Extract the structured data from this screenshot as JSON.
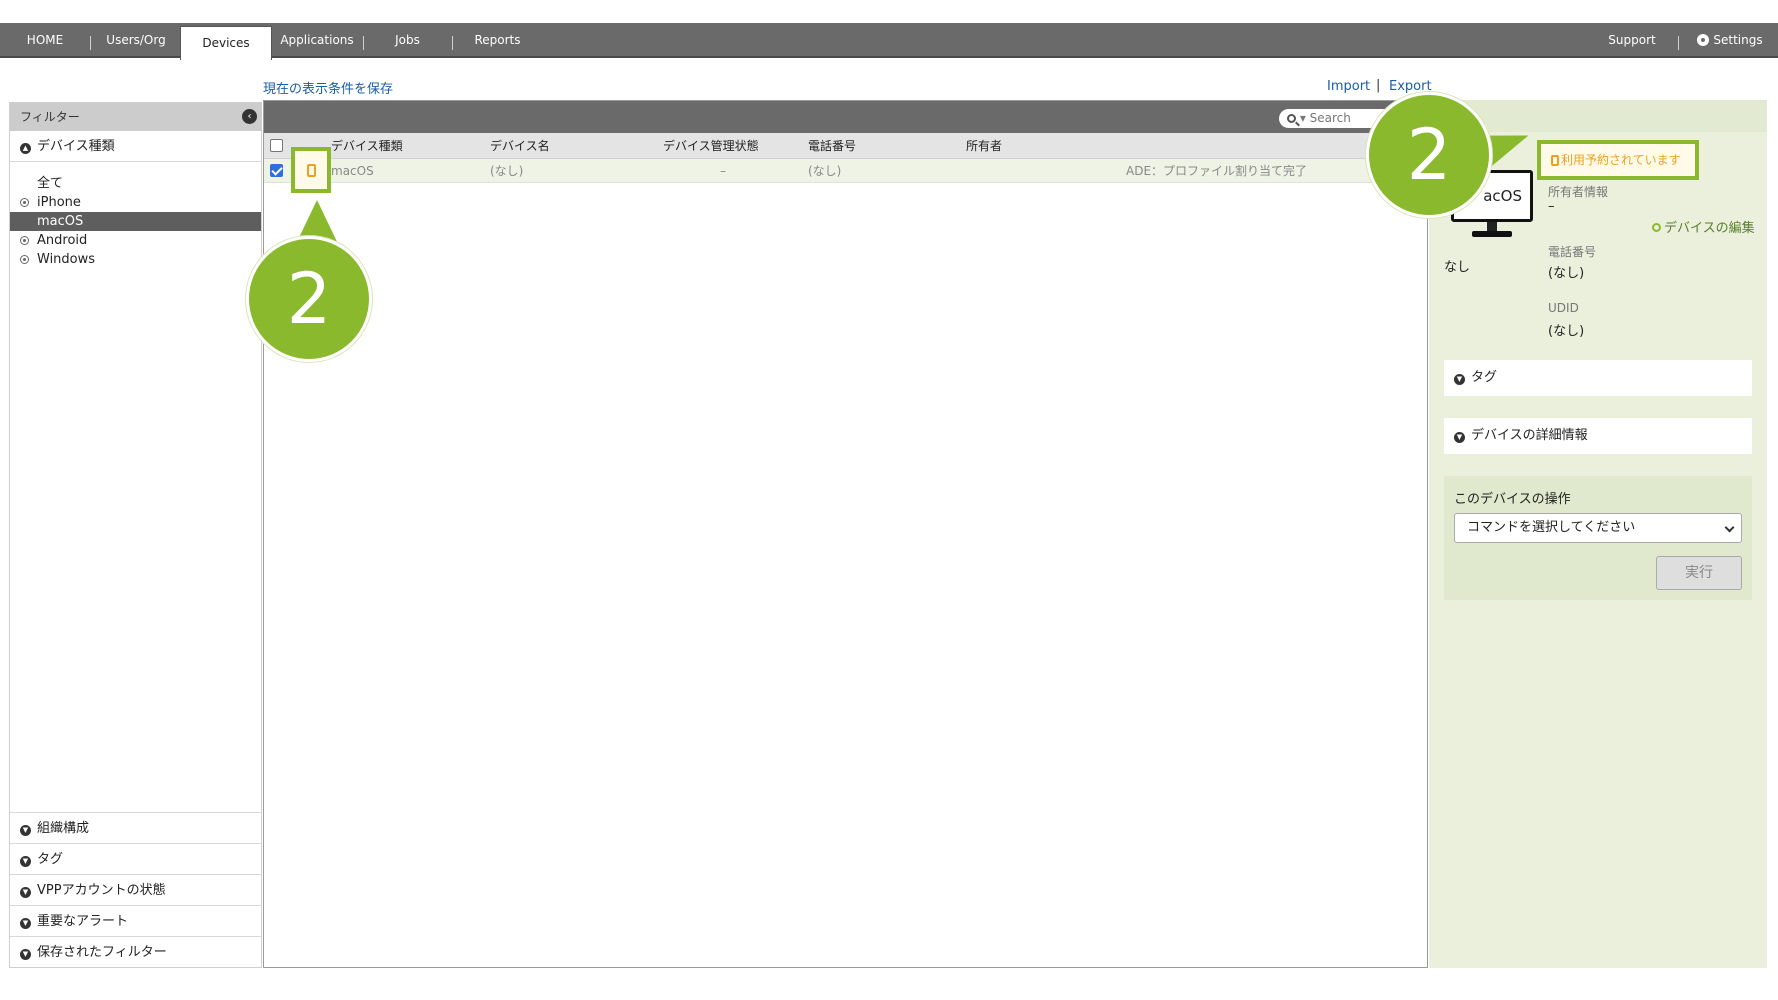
{
  "nav": {
    "tabs": [
      "HOME",
      "Users/Org",
      "Devices",
      "Applications",
      "Jobs",
      "Reports"
    ],
    "support": "Support",
    "settings": "Settings"
  },
  "toolbar": {
    "save_view": "現在の表示条件を保存",
    "import": "Import",
    "separator": "|",
    "export": "Export"
  },
  "sidebar": {
    "title": "フィルター",
    "device_type_section": "デバイス種類",
    "filters": [
      "全て",
      "iPhone",
      "macOS",
      "Android",
      "Windows"
    ],
    "bottom_sections": [
      "組織構成",
      "タグ",
      "VPPアカウントの状態",
      "重要なアラート",
      "保存されたフィルター"
    ]
  },
  "list": {
    "search_placeholder": "Search",
    "columns": [
      "デバイス種類",
      "デバイス名",
      "デバイス管理状態",
      "電話番号",
      "所有者"
    ],
    "rows": [
      {
        "type": "macOS",
        "name": "(なし)",
        "status": "–",
        "phone": "(なし)",
        "owner": "",
        "note": "ADE：プロファイル割り当て完了"
      }
    ]
  },
  "detail": {
    "monitor_text": "acOS",
    "reserved_badge": "利用予約されています",
    "owner_label": "所有者情報",
    "owner_value": "–",
    "edit_link": "デバイスの編集",
    "name_value": "なし",
    "phone_label": "電話番号",
    "phone_value": "(なし)",
    "udid_label": "UDID",
    "udid_value": "(なし)",
    "tag_section": "タグ",
    "details_section": "デバイスの詳細情報",
    "ops_title": "このデバイスの操作",
    "command_select": "コマンドを選択してください",
    "execute_button": "実行"
  },
  "callouts": {
    "left_number": "2",
    "right_number": "2"
  },
  "colors": {
    "accent": "#8ab92d",
    "nav_bg": "#6a6a6a",
    "warning": "#f0a020",
    "link": "#1a5da8"
  }
}
